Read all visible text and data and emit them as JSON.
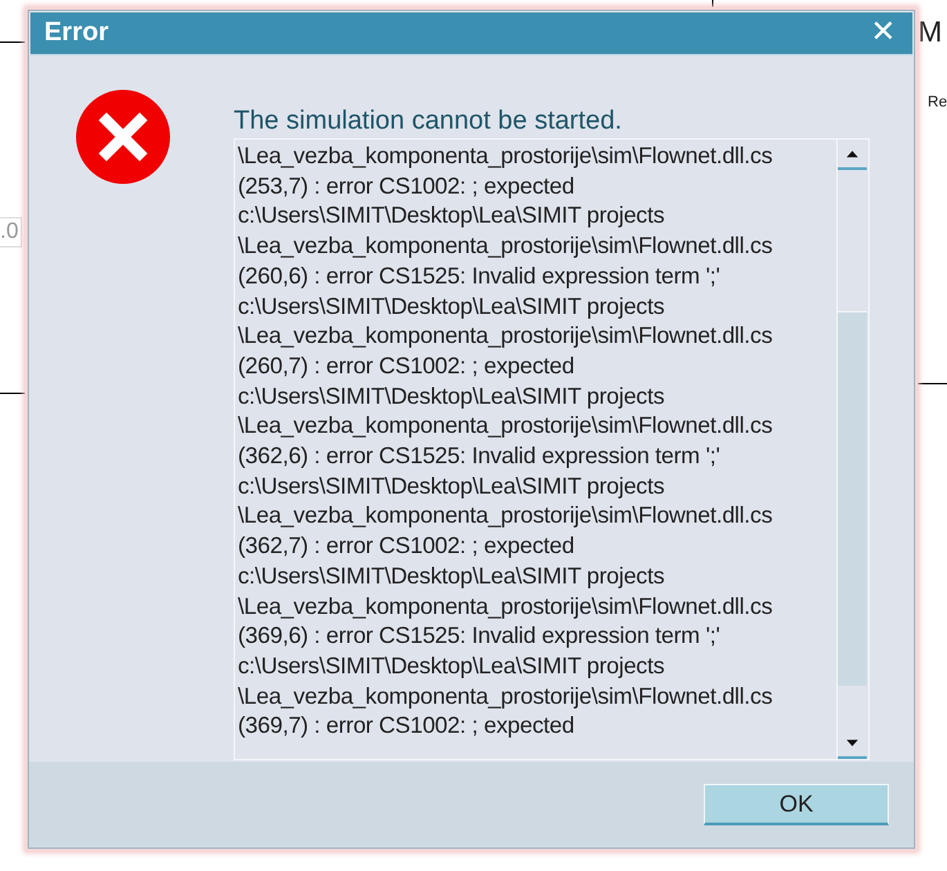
{
  "background": {
    "texts": [
      {
        "kind": "heading",
        "text": "M"
      },
      {
        "kind": "label",
        "text": "Re"
      },
      {
        "kind": "value",
        "text": ".0"
      }
    ]
  },
  "window": {
    "title": "Error",
    "close": "✕"
  },
  "message": {
    "heading": "The simulation cannot be started.",
    "lines": [
      "\\Lea_vezba_komponenta_prostorije\\sim\\Flownet.dll.cs",
      "(253,7) : error CS1002: ; expected",
      "c:\\Users\\SIMIT\\Desktop\\Lea\\SIMIT projects",
      "\\Lea_vezba_komponenta_prostorije\\sim\\Flownet.dll.cs",
      "(260,6) : error CS1525: Invalid expression term ';'",
      "c:\\Users\\SIMIT\\Desktop\\Lea\\SIMIT projects",
      "\\Lea_vezba_komponenta_prostorije\\sim\\Flownet.dll.cs",
      "(260,7) : error CS1002: ; expected",
      "c:\\Users\\SIMIT\\Desktop\\Lea\\SIMIT projects",
      "\\Lea_vezba_komponenta_prostorije\\sim\\Flownet.dll.cs",
      "(362,6) : error CS1525: Invalid expression term ';'",
      "c:\\Users\\SIMIT\\Desktop\\Lea\\SIMIT projects",
      "\\Lea_vezba_komponenta_prostorije\\sim\\Flownet.dll.cs",
      "(362,7) : error CS1002: ; expected",
      "c:\\Users\\SIMIT\\Desktop\\Lea\\SIMIT projects",
      "\\Lea_vezba_komponenta_prostorije\\sim\\Flownet.dll.cs",
      "(369,6) : error CS1525: Invalid expression term ';'",
      "c:\\Users\\SIMIT\\Desktop\\Lea\\SIMIT projects",
      "\\Lea_vezba_komponenta_prostorije\\sim\\Flownet.dll.cs",
      "(369,7) : error CS1002: ; expected"
    ]
  },
  "buttons": [
    {
      "label": "OK"
    }
  ]
}
